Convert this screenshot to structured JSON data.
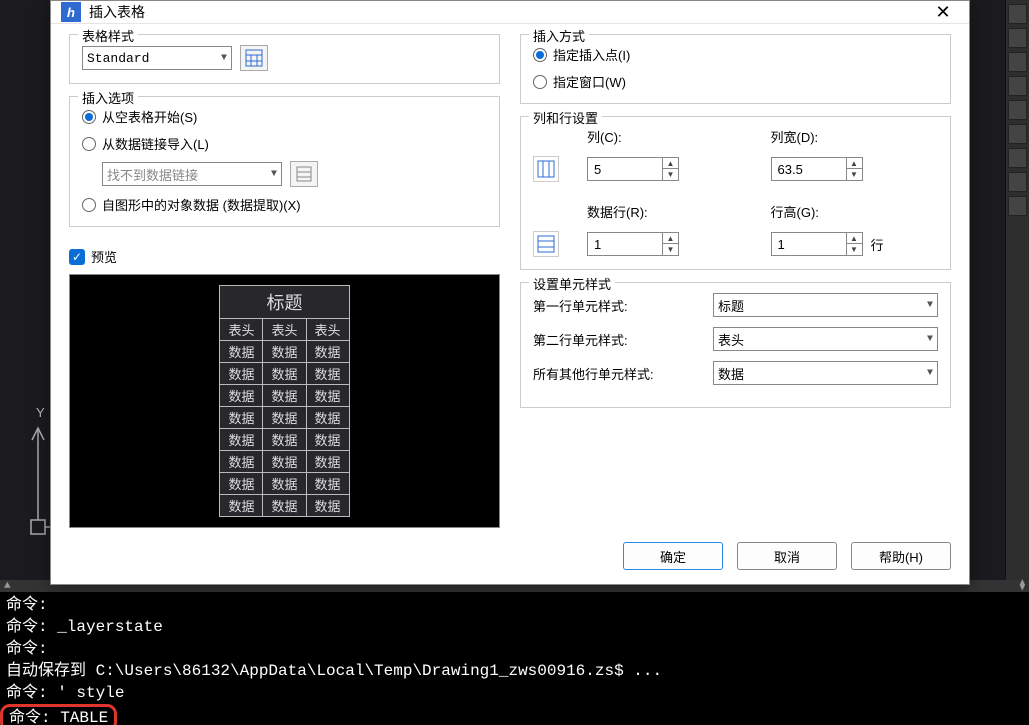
{
  "dialog": {
    "title": "插入表格",
    "table_style": {
      "legend": "表格样式",
      "value": "Standard"
    },
    "insert_options": {
      "legend": "插入选项",
      "from_blank": "从空表格开始(S)",
      "from_link": "从数据链接导入(L)",
      "no_link_text": "找不到数据链接",
      "from_extract": "自图形中的对象数据 (数据提取)(X)"
    },
    "preview_label": "预览",
    "preview": {
      "title": "标题",
      "header": "表头",
      "data": "数据"
    },
    "insert_method": {
      "legend": "插入方式",
      "point": "指定插入点(I)",
      "window": "指定窗口(W)"
    },
    "colrow": {
      "legend": "列和行设置",
      "cols_label": "列(C):",
      "colw_label": "列宽(D):",
      "cols": "5",
      "colw": "63.5",
      "datarow_label": "数据行(R):",
      "rowh_label": "行高(G):",
      "datarow": "1",
      "rowh": "1",
      "row_unit": "行"
    },
    "cellstyle": {
      "legend": "设置单元样式",
      "first": "第一行单元样式:",
      "second": "第二行单元样式:",
      "rest": "所有其他行单元样式:",
      "v_first": "标题",
      "v_second": "表头",
      "v_rest": "数据"
    },
    "buttons": {
      "ok": "确定",
      "cancel": "取消",
      "help": "帮助(H)"
    }
  },
  "cmd": {
    "l1": "命令:",
    "l2": "命令: _layerstate",
    "l3": "命令:",
    "l4": "自动保存到 C:\\Users\\86132\\AppData\\Local\\Temp\\Drawing1_zws00916.zs$ ...",
    "l5": "命令: ' style",
    "l6": "命令: TABLE"
  }
}
